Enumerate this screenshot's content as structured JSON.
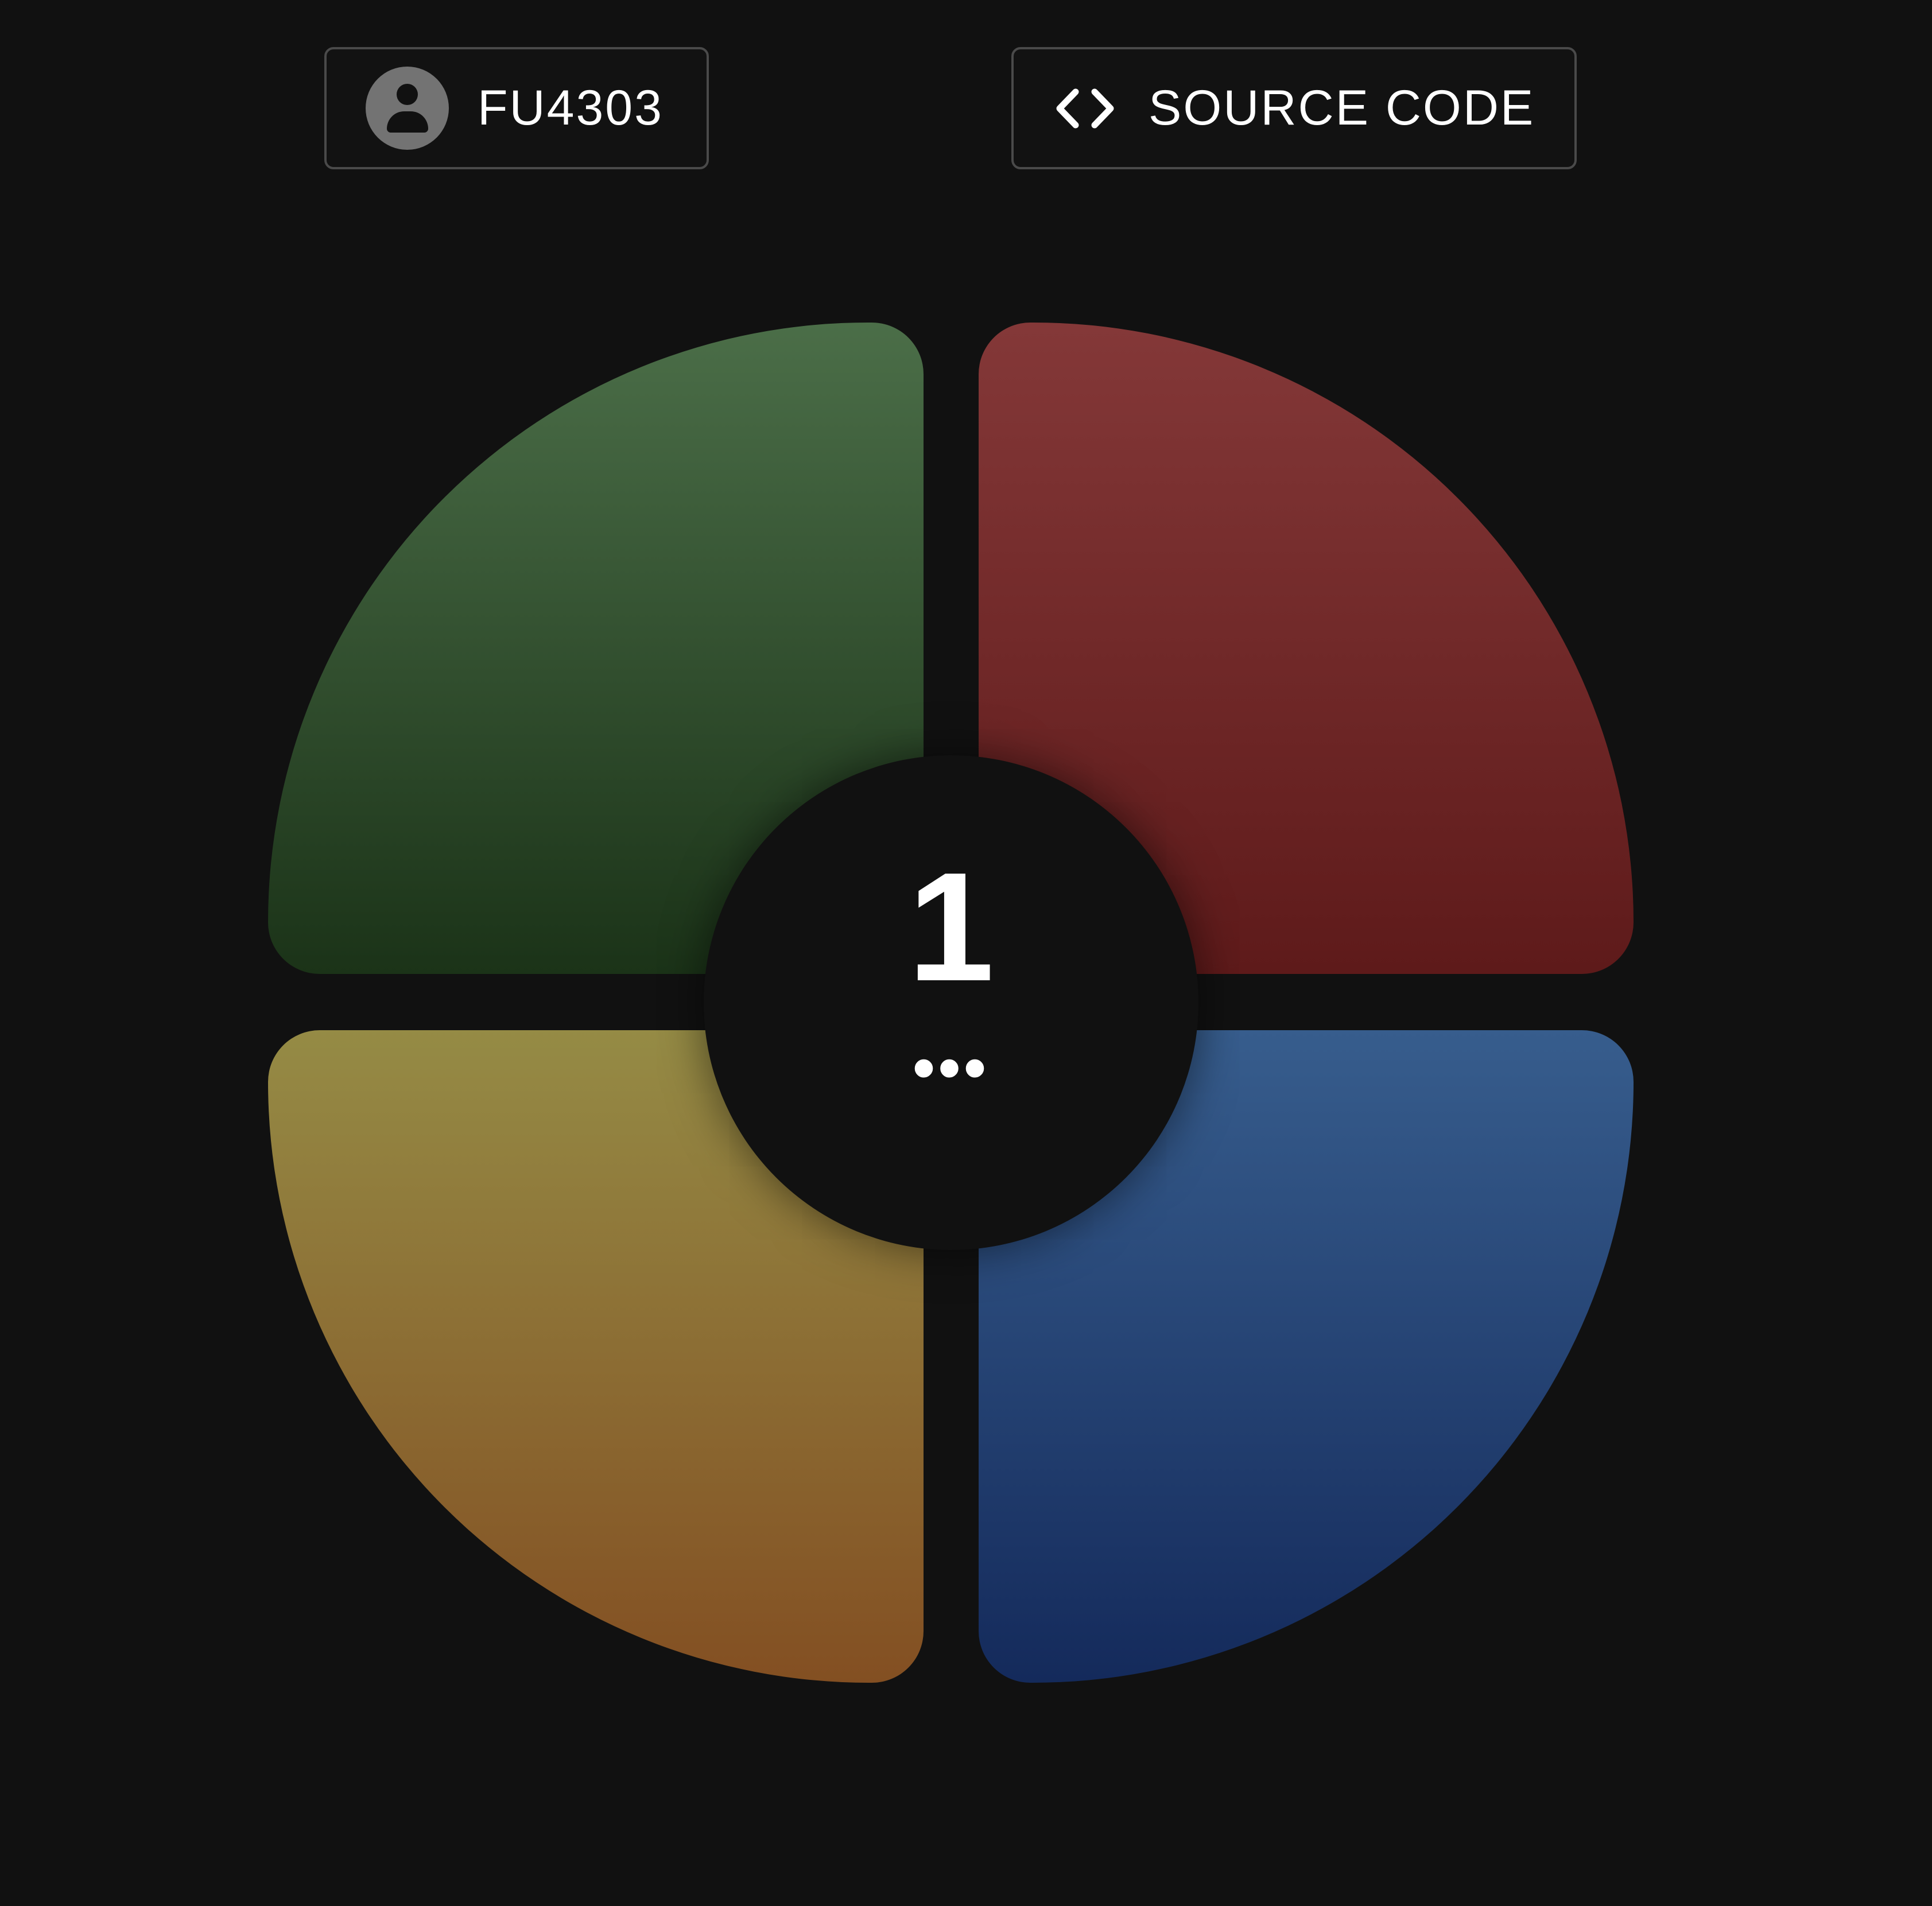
{
  "header": {
    "user": {
      "label": "FU4303",
      "icon": "person-icon"
    },
    "source_code": {
      "label": "SOURCE CODE",
      "icon": "code-brackets-icon"
    }
  },
  "game": {
    "round": "1",
    "status": "•••",
    "pads": [
      {
        "name": "green",
        "color": "#3f5f39"
      },
      {
        "name": "red",
        "color": "#6e2626"
      },
      {
        "name": "yellow",
        "color": "#8a7836"
      },
      {
        "name": "blue",
        "color": "#27457a"
      }
    ]
  },
  "colors": {
    "background": "#111111",
    "button_border": "#4a4a4a",
    "avatar": "#737373",
    "text": "#ffffff"
  }
}
